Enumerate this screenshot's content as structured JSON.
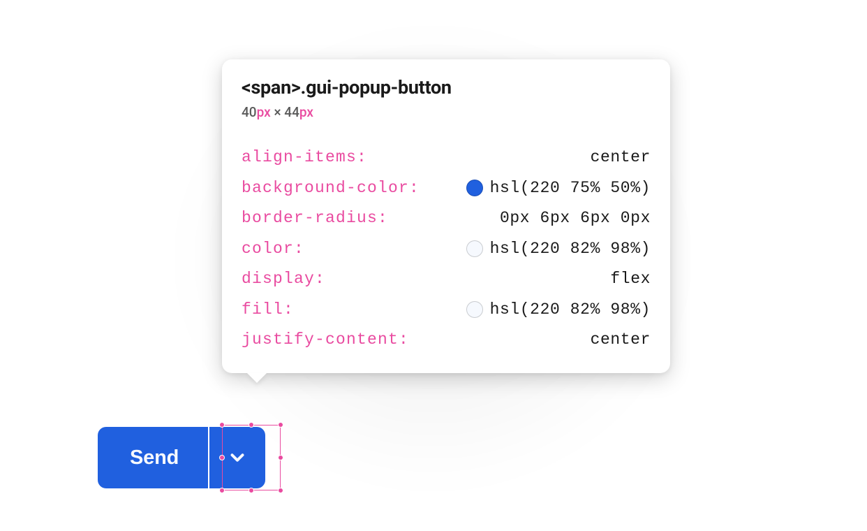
{
  "tooltip": {
    "selector": "<span>.gui-popup-button",
    "dims_w": "40",
    "dims_h": "44",
    "dims_unit": "px",
    "dims_sep": " × ",
    "props": [
      {
        "name": "align-items:",
        "value": "center",
        "swatch": null
      },
      {
        "name": "background-color:",
        "value": "hsl(220 75% 50%)",
        "swatch": "hsl(220 75% 50%)"
      },
      {
        "name": "border-radius:",
        "value": "0px 6px 6px 0px",
        "swatch": null
      },
      {
        "name": "color:",
        "value": "hsl(220 82% 98%)",
        "swatch": "hsl(220 82% 98%)"
      },
      {
        "name": "display:",
        "value": "flex",
        "swatch": null
      },
      {
        "name": "fill:",
        "value": "hsl(220 82% 98%)",
        "swatch": "hsl(220 82% 98%)"
      },
      {
        "name": "justify-content:",
        "value": "center",
        "swatch": null
      }
    ]
  },
  "button": {
    "send_label": "Send"
  },
  "colors": {
    "accent_blue": "hsl(220 75% 50%)",
    "text_light": "hsl(220 82% 98%)",
    "pink": "#e94ba0"
  }
}
